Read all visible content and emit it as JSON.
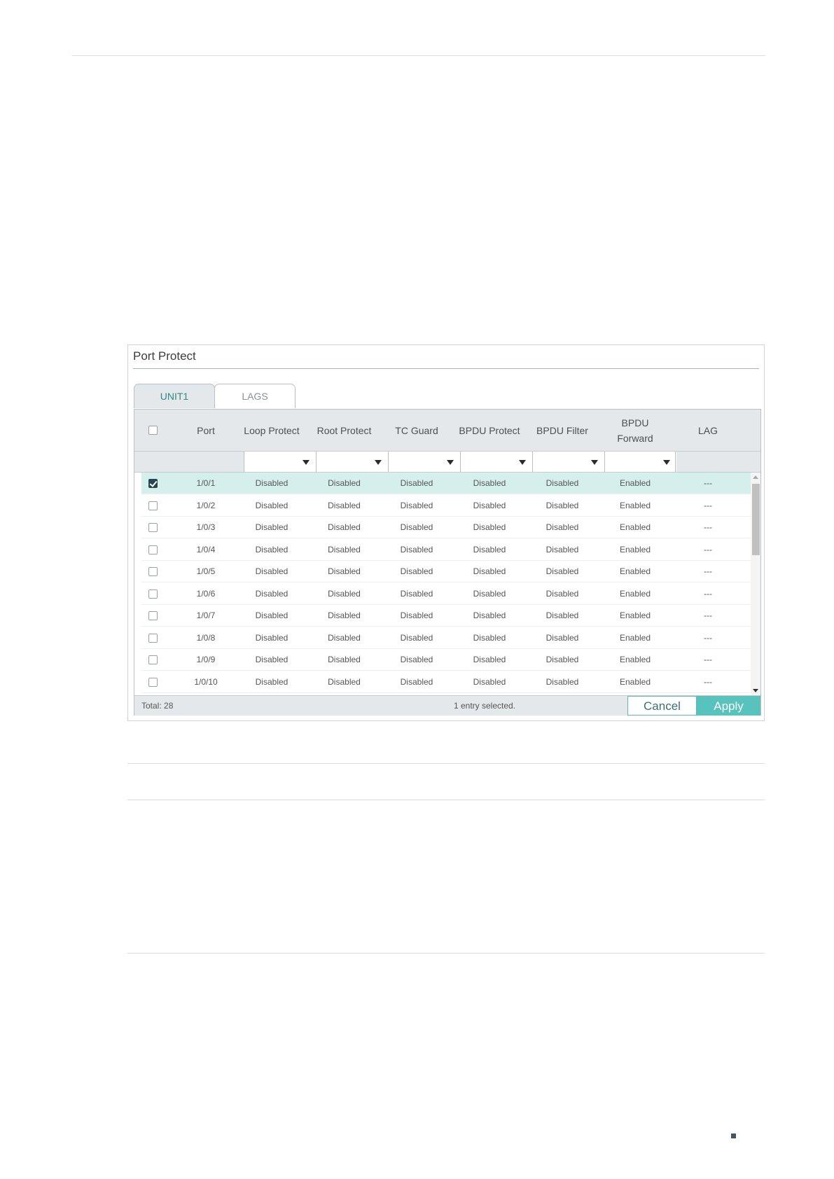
{
  "panel": {
    "title": "Port Protect",
    "tabs": [
      {
        "label": "UNIT1",
        "active": true
      },
      {
        "label": "LAGS",
        "active": false
      }
    ]
  },
  "table": {
    "headers": {
      "port": "Port",
      "loop_protect": "Loop Protect",
      "root_protect": "Root Protect",
      "tc_guard": "TC Guard",
      "bpdu_protect": "BPDU Protect",
      "bpdu_filter": "BPDU Filter",
      "bpdu_forward_line1": "BPDU",
      "bpdu_forward_line2": "Forward",
      "lag": "LAG"
    },
    "rows": [
      {
        "port": "1/0/1",
        "loop": "Disabled",
        "root": "Disabled",
        "tc": "Disabled",
        "bprotect": "Disabled",
        "bfilter": "Disabled",
        "bforward": "Enabled",
        "lag": "---",
        "checked": true
      },
      {
        "port": "1/0/2",
        "loop": "Disabled",
        "root": "Disabled",
        "tc": "Disabled",
        "bprotect": "Disabled",
        "bfilter": "Disabled",
        "bforward": "Enabled",
        "lag": "---",
        "checked": false
      },
      {
        "port": "1/0/3",
        "loop": "Disabled",
        "root": "Disabled",
        "tc": "Disabled",
        "bprotect": "Disabled",
        "bfilter": "Disabled",
        "bforward": "Enabled",
        "lag": "---",
        "checked": false
      },
      {
        "port": "1/0/4",
        "loop": "Disabled",
        "root": "Disabled",
        "tc": "Disabled",
        "bprotect": "Disabled",
        "bfilter": "Disabled",
        "bforward": "Enabled",
        "lag": "---",
        "checked": false
      },
      {
        "port": "1/0/5",
        "loop": "Disabled",
        "root": "Disabled",
        "tc": "Disabled",
        "bprotect": "Disabled",
        "bfilter": "Disabled",
        "bforward": "Enabled",
        "lag": "---",
        "checked": false
      },
      {
        "port": "1/0/6",
        "loop": "Disabled",
        "root": "Disabled",
        "tc": "Disabled",
        "bprotect": "Disabled",
        "bfilter": "Disabled",
        "bforward": "Enabled",
        "lag": "---",
        "checked": false
      },
      {
        "port": "1/0/7",
        "loop": "Disabled",
        "root": "Disabled",
        "tc": "Disabled",
        "bprotect": "Disabled",
        "bfilter": "Disabled",
        "bforward": "Enabled",
        "lag": "---",
        "checked": false
      },
      {
        "port": "1/0/8",
        "loop": "Disabled",
        "root": "Disabled",
        "tc": "Disabled",
        "bprotect": "Disabled",
        "bfilter": "Disabled",
        "bforward": "Enabled",
        "lag": "---",
        "checked": false
      },
      {
        "port": "1/0/9",
        "loop": "Disabled",
        "root": "Disabled",
        "tc": "Disabled",
        "bprotect": "Disabled",
        "bfilter": "Disabled",
        "bforward": "Enabled",
        "lag": "---",
        "checked": false
      },
      {
        "port": "1/0/10",
        "loop": "Disabled",
        "root": "Disabled",
        "tc": "Disabled",
        "bprotect": "Disabled",
        "bfilter": "Disabled",
        "bforward": "Enabled",
        "lag": "---",
        "checked": false
      }
    ]
  },
  "footer": {
    "total": "Total: 28",
    "selected_info": "1 entry selected.",
    "cancel_label": "Cancel",
    "apply_label": "Apply"
  },
  "colors": {
    "accent": "#58c2bd",
    "selected_row": "#d5f0ec",
    "header_bg": "#e4e8ea",
    "checkbox_checked": "#26474f"
  }
}
